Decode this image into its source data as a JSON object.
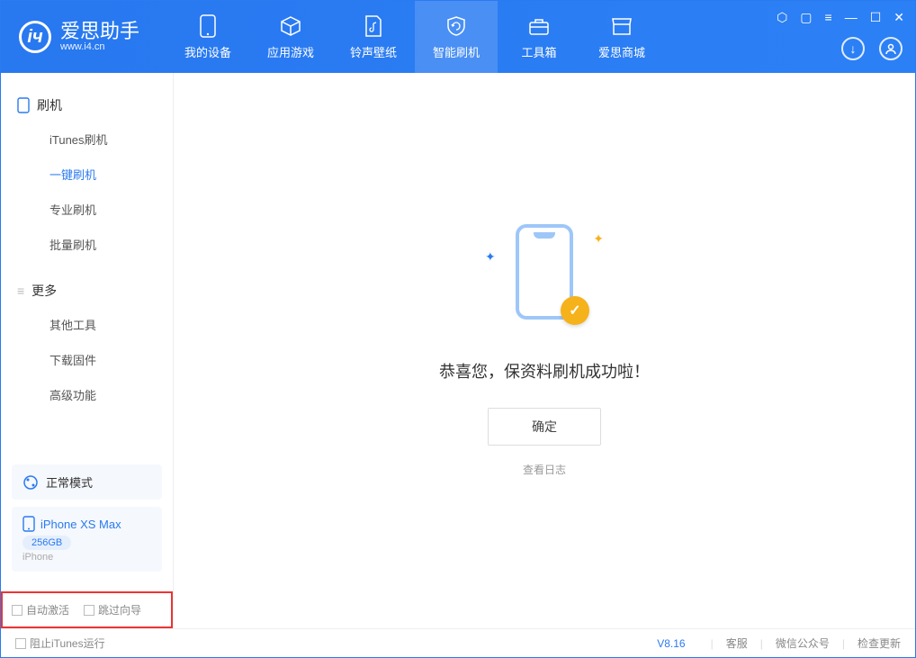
{
  "app": {
    "name": "爱思助手",
    "url": "www.i4.cn"
  },
  "tabs": [
    {
      "label": "我的设备"
    },
    {
      "label": "应用游戏"
    },
    {
      "label": "铃声壁纸"
    },
    {
      "label": "智能刷机"
    },
    {
      "label": "工具箱"
    },
    {
      "label": "爱思商城"
    }
  ],
  "sidebar": {
    "group1": "刷机",
    "items1": [
      "iTunes刷机",
      "一键刷机",
      "专业刷机",
      "批量刷机"
    ],
    "group2": "更多",
    "items2": [
      "其他工具",
      "下载固件",
      "高级功能"
    ]
  },
  "mode": {
    "label": "正常模式"
  },
  "device": {
    "name": "iPhone XS Max",
    "capacity": "256GB",
    "type": "iPhone"
  },
  "red_checks": {
    "auto_activate": "自动激活",
    "skip_guide": "跳过向导"
  },
  "main": {
    "success": "恭喜您，保资料刷机成功啦！",
    "ok": "确定",
    "view_log": "查看日志"
  },
  "footer": {
    "block_itunes": "阻止iTunes运行",
    "version": "V8.16",
    "links": [
      "客服",
      "微信公众号",
      "检查更新"
    ]
  }
}
